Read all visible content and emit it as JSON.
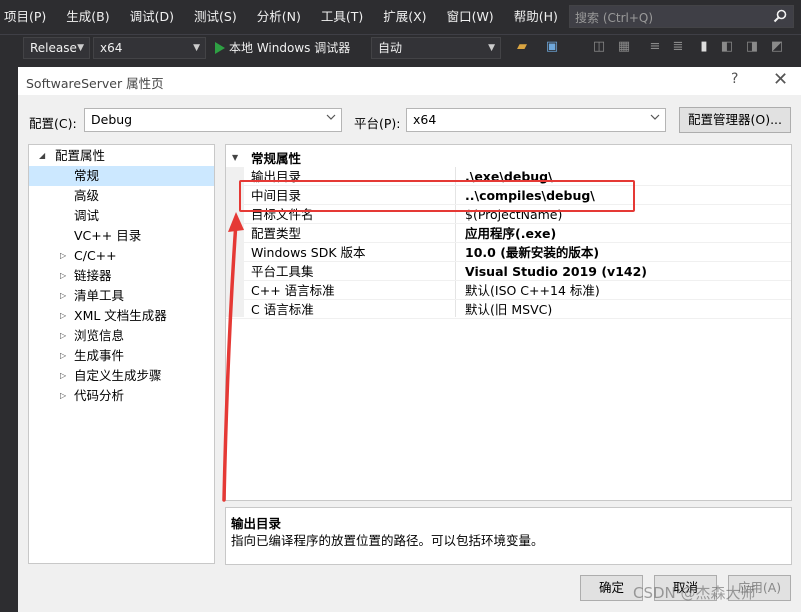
{
  "menubar": {
    "items": [
      "项目(P)",
      "生成(B)",
      "调试(D)",
      "测试(S)",
      "分析(N)",
      "工具(T)",
      "扩展(X)",
      "窗口(W)",
      "帮助(H)"
    ],
    "search_placeholder": "搜索 (Ctrl+Q)"
  },
  "toolbar": {
    "configuration": "Release",
    "platform": "x64",
    "run_label": "本地 Windows 调试器",
    "mode": "自动"
  },
  "dialog": {
    "title": "SoftwareServer 属性页",
    "help": "?",
    "config_label": "配置(C):",
    "config_value": "Debug",
    "platform_label": "平台(P):",
    "platform_value": "x64",
    "config_manager_button": "配置管理器(O)...",
    "tree": [
      {
        "label": "配置属性",
        "level": 0,
        "expander": "open"
      },
      {
        "label": "常规",
        "level": 1,
        "selected": true
      },
      {
        "label": "高级",
        "level": 1
      },
      {
        "label": "调试",
        "level": 1
      },
      {
        "label": "VC++ 目录",
        "level": 1
      },
      {
        "label": "C/C++",
        "level": 1,
        "expander": "closed"
      },
      {
        "label": "链接器",
        "level": 1,
        "expander": "closed"
      },
      {
        "label": "清单工具",
        "level": 1,
        "expander": "closed"
      },
      {
        "label": "XML 文档生成器",
        "level": 1,
        "expander": "closed"
      },
      {
        "label": "浏览信息",
        "level": 1,
        "expander": "closed"
      },
      {
        "label": "生成事件",
        "level": 1,
        "expander": "closed"
      },
      {
        "label": "自定义生成步骤",
        "level": 1,
        "expander": "closed"
      },
      {
        "label": "代码分析",
        "level": 1,
        "expander": "closed"
      }
    ],
    "grid": {
      "category": "常规属性",
      "rows": [
        {
          "name": "输出目录",
          "value": ".\\exe\\debug\\",
          "bold": true
        },
        {
          "name": "中间目录",
          "value": "..\\compiles\\debug\\",
          "bold": true
        },
        {
          "name": "目标文件名",
          "value": "$(ProjectName)",
          "bold": false
        },
        {
          "name": "配置类型",
          "value": "应用程序(.exe)",
          "bold": true
        },
        {
          "name": "Windows SDK 版本",
          "value": "10.0 (最新安装的版本)",
          "bold": true
        },
        {
          "name": "平台工具集",
          "value": "Visual Studio 2019 (v142)",
          "bold": true
        },
        {
          "name": "C++ 语言标准",
          "value": "默认(ISO C++14 标准)",
          "bold": false
        },
        {
          "name": "C 语言标准",
          "value": "默认(旧 MSVC)",
          "bold": false
        }
      ]
    },
    "description": {
      "title": "输出目录",
      "text": "指向已编译程序的放置位置的路径。可以包括环境变量。"
    },
    "buttons": {
      "ok": "确定",
      "cancel": "取消",
      "apply": "应用(A)"
    }
  },
  "annotation_color": "#e53935",
  "watermark": "CSDN @杰森大师"
}
